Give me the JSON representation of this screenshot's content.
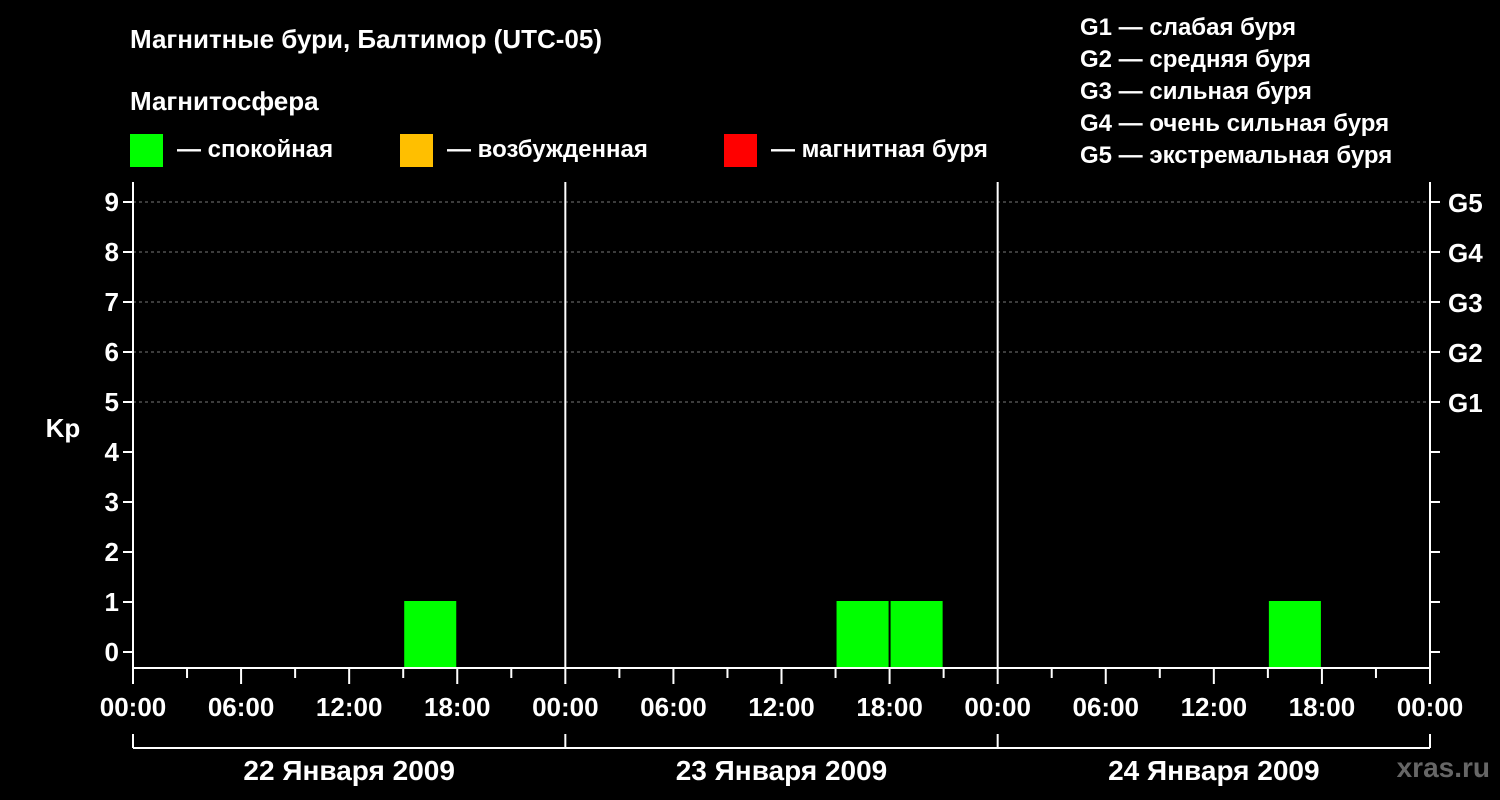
{
  "title": "Магнитные бури, Балтимор (UTC-05)",
  "magnetosphere": {
    "heading": "Магнитосфера",
    "items": [
      {
        "label": "— спокойная",
        "color": "#00ff00"
      },
      {
        "label": "— возбужденная",
        "color": "#ffbf00"
      },
      {
        "label": "— магнитная буря",
        "color": "#ff0000"
      }
    ]
  },
  "g_legend": [
    "G1 — слабая буря",
    "G2 — средняя буря",
    "G3 — сильная буря",
    "G4 — очень сильная буря",
    "G5 — экстремальная буря"
  ],
  "watermark": "xras.ru",
  "chart_data": {
    "type": "bar",
    "ylabel": "Kp",
    "ylim": [
      0,
      9
    ],
    "yticks": [
      "0",
      "1",
      "2",
      "3",
      "4",
      "5",
      "6",
      "7",
      "8",
      "9"
    ],
    "right_ticks": [
      {
        "kp": 5,
        "label": "G1"
      },
      {
        "kp": 6,
        "label": "G2"
      },
      {
        "kp": 7,
        "label": "G3"
      },
      {
        "kp": 8,
        "label": "G4"
      },
      {
        "kp": 9,
        "label": "G5"
      }
    ],
    "xrange_hours": [
      0,
      72
    ],
    "xticks": [
      "00:00",
      "06:00",
      "12:00",
      "18:00",
      "00:00",
      "06:00",
      "12:00",
      "18:00",
      "00:00",
      "06:00",
      "12:00",
      "18:00",
      "00:00"
    ],
    "days": [
      "22 Января 2009",
      "23 Января 2009",
      "24 Января 2009"
    ],
    "grid": true,
    "bars": [
      {
        "start_hour": 15,
        "end_hour": 18,
        "kp": 1,
        "color": "#00ff00"
      },
      {
        "start_hour": 39,
        "end_hour": 42,
        "kp": 1,
        "color": "#00ff00"
      },
      {
        "start_hour": 42,
        "end_hour": 45,
        "kp": 1,
        "color": "#00ff00"
      },
      {
        "start_hour": 63,
        "end_hour": 66,
        "kp": 1,
        "color": "#00ff00"
      }
    ]
  }
}
